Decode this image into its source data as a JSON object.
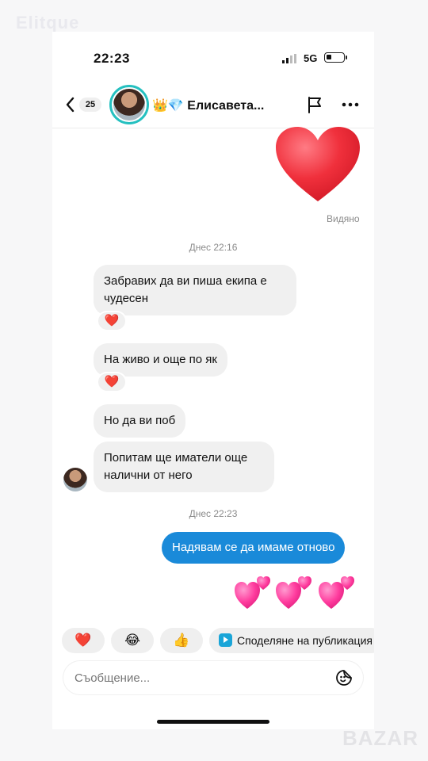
{
  "watermark_top": "Elitque",
  "watermark_bottom": "BAZAR",
  "status": {
    "time": "22:23",
    "network": "5G"
  },
  "header": {
    "unread_count": "25",
    "contact_name": "👑💎 Елисавета..."
  },
  "seen_label": "Видяно",
  "timestamps": [
    "Днес 22:16",
    "Днес 22:23"
  ],
  "messages_in": [
    {
      "text": "Забравих да ви пиша екипа е чудесен",
      "reaction": "❤️"
    },
    {
      "text": "На живо и още по як",
      "reaction": "❤️"
    },
    {
      "text": "Но да ви поб"
    },
    {
      "text": "Попитам ще иматели още налични от него"
    }
  ],
  "message_out": {
    "text": "Надявам се да имаме отново"
  },
  "quick_replies": {
    "heart": "❤️",
    "laugh": "😂",
    "thumb": "👍",
    "share": "Споделяне на публикация"
  },
  "composer": {
    "placeholder": "Съобщение..."
  },
  "colors": {
    "outgoing_bubble": "#1a8ad9",
    "avatar_ring": "#25c0c0",
    "heart_red": "#f0303c",
    "heart_pink": "#ff3c9e"
  }
}
